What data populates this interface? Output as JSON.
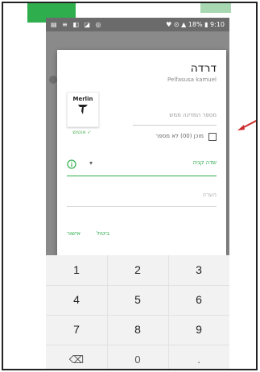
{
  "statusbar": {
    "left_icons": "▤ ≡ ◧ ◪ ◎",
    "right": "♥ ⊙ ▲ 18% ▮ 9:10"
  },
  "dialog": {
    "title": "דרדה",
    "subtitle": "Pelfasusa kamuel",
    "logo": {
      "brand": "Merlin",
      "caption": "אנטוש ✓"
    },
    "input_placeholder": "מספר המדינה ממש",
    "checkbox_label": "מוכן (00) לא מספר",
    "field_label": "שדה קניה",
    "field_dropdown": "▾",
    "note_placeholder": "הערה",
    "actions": {
      "confirm": "אישור",
      "cancel": "ביטול"
    }
  },
  "keypad": {
    "rows": [
      [
        "1",
        "2",
        "3"
      ],
      [
        "4",
        "5",
        "6"
      ],
      [
        "7",
        "8",
        "9"
      ],
      [
        "⌫",
        "0",
        "."
      ]
    ]
  },
  "colors": {
    "accent": "#2fae4e",
    "annotation": "#cc2b2b"
  }
}
